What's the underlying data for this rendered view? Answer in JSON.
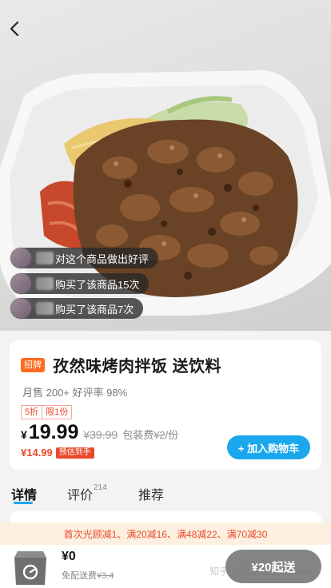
{
  "hero": {
    "image_alt": "",
    "bubbles": [
      {
        "text": "对这个商品做出好评"
      },
      {
        "text": "购买了该商品15次"
      },
      {
        "text": "购买了该商品7次"
      }
    ]
  },
  "product": {
    "signature_tag": "招牌",
    "title": "孜然味烤肉拌饭 送饮料",
    "sales": "月售 200+ 好评率 98%",
    "promo_tags": [
      "5折",
      "限1份"
    ],
    "currency": "¥",
    "price": "19.99",
    "original_price": "¥39.99",
    "packing_label": "包装费",
    "packing_fee": "¥2",
    "packing_unit": "/份",
    "member_price": "¥14.99",
    "member_tag": "预估到手",
    "add_cart_label": "+ 加入购物车"
  },
  "tabs": [
    {
      "label": "详情",
      "count": ""
    },
    {
      "label": "评价",
      "count": "214"
    },
    {
      "label": "推荐",
      "count": ""
    }
  ],
  "discount_bar": "首次光顾减1、满20减16、满48减22、满70减30",
  "bottom": {
    "total": "¥0",
    "free_ship_label": "免配送费",
    "original_ship": "¥3.4",
    "min_order_label": "¥20起送",
    "watermark": "知乎 @天空之城heaven"
  },
  "colors": {
    "accent": "#1aa7ec",
    "sale": "#e8492a",
    "signature": "#ff6a1f"
  }
}
